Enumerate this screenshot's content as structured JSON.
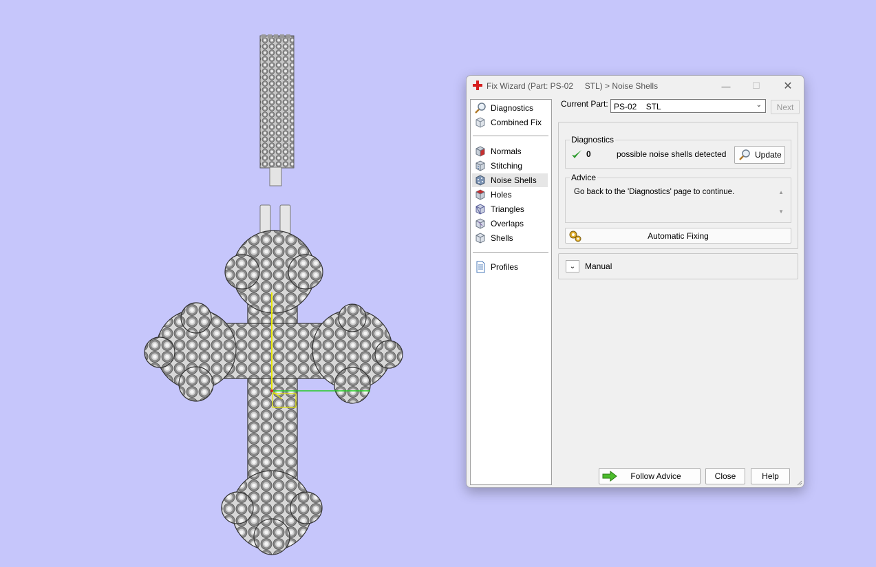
{
  "dialog": {
    "title": "Fix Wizard (Part: PS-02     STL) > Noise Shells",
    "title_icon": "red-cross-icon",
    "controls": {
      "minimize": "—",
      "maximize": "☐",
      "close": "✕"
    }
  },
  "nav": {
    "group1": [
      {
        "label": "Diagnostics",
        "icon": "magnifier-icon"
      },
      {
        "label": "Combined Fix",
        "icon": "cube-icon"
      }
    ],
    "group2": [
      {
        "label": "Normals",
        "icon": "normals-cube-icon"
      },
      {
        "label": "Stitching",
        "icon": "stitching-cube-icon"
      },
      {
        "label": "Noise Shells",
        "icon": "noise-shells-icon",
        "selected": true
      },
      {
        "label": "Holes",
        "icon": "holes-cube-icon"
      },
      {
        "label": "Triangles",
        "icon": "triangles-cube-icon"
      },
      {
        "label": "Overlaps",
        "icon": "overlaps-cube-icon"
      },
      {
        "label": "Shells",
        "icon": "shells-cube-icon"
      }
    ],
    "group3": [
      {
        "label": "Profiles",
        "icon": "document-icon"
      }
    ]
  },
  "current_part": {
    "label": "Current Part:",
    "value": "PS-02    STL",
    "next_label": "Next"
  },
  "diagnostics": {
    "legend": "Diagnostics",
    "count": "0",
    "text": "possible noise shells detected",
    "update_label": "Update",
    "status_color": "#2e9b2e"
  },
  "advice": {
    "legend": "Advice",
    "text": "Go back to the 'Diagnostics' page to continue."
  },
  "auto_fix_label": "Automatic Fixing",
  "manual_label": "Manual",
  "footer": {
    "follow_advice": "Follow Advice",
    "close": "Close",
    "help": "Help"
  },
  "colors": {
    "background": "#c6c6fb",
    "accent_green": "#2e9b2e",
    "axis_y": "#e6e600",
    "axis_x": "#22cc22"
  }
}
